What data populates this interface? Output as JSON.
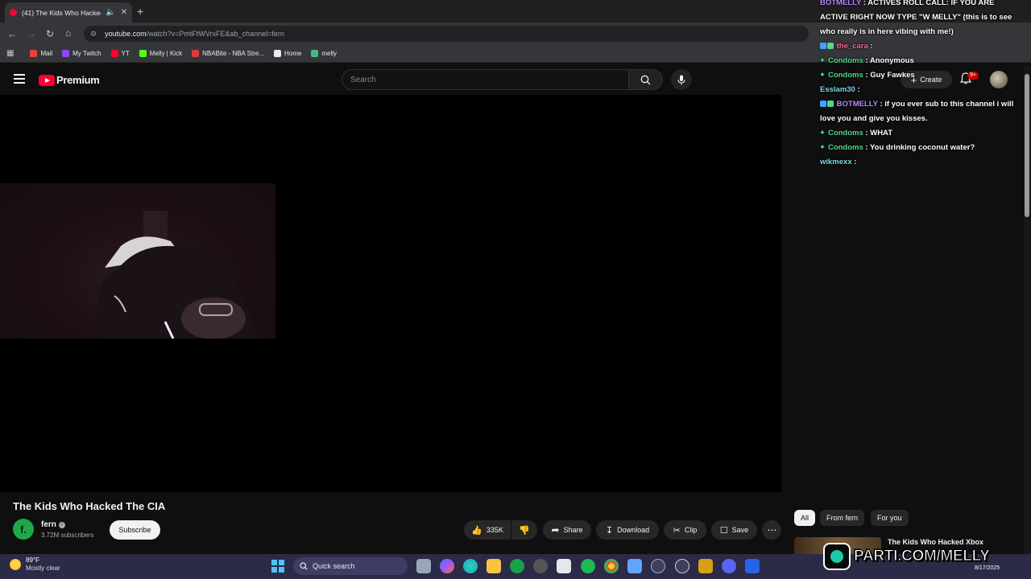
{
  "browser": {
    "tab_title": "(41) The Kids Who Hacked",
    "url_host": "youtube.com",
    "url_path": "/watch?v=PmtFtWVrxFE&ab_channel=fern",
    "bookmarks": [
      {
        "label": "Mail",
        "color": "#ea4335"
      },
      {
        "label": "My Twitch",
        "color": "#9146ff"
      },
      {
        "label": "YT",
        "color": "#ff0033"
      },
      {
        "label": "Melly | Kick",
        "color": "#53fc18"
      },
      {
        "label": "NBABite - NBA Stre...",
        "color": "#e03a3a"
      },
      {
        "label": "Home",
        "color": "#e8eaed"
      },
      {
        "label": "melly",
        "color": "#3fbf7f"
      }
    ]
  },
  "youtube": {
    "logo_text": "Premium",
    "search_placeholder": "Search",
    "create_label": "Create",
    "notif_count": "9+"
  },
  "chat": [
    {
      "prefix": "",
      "user": "BOTMELLY",
      "user_color": "#b389ff",
      "text": ": ACTIVES ROLL CALL: IF YOU ARE"
    },
    {
      "prefix": "",
      "user": "",
      "user_color": "#ffffff",
      "text": "ACTIVE RIGHT NOW TYPE \"W MELLY\" (this is to see"
    },
    {
      "prefix": "",
      "user": "",
      "user_color": "#ffffff",
      "text": "who really is in here vibing with me!)"
    },
    {
      "prefix": "badges",
      "user": "the_cara",
      "user_color": "#ff6b9a",
      "text": ":"
    },
    {
      "prefix": "sparkle",
      "user": "Condoms",
      "user_color": "#58d68d",
      "text": ": Anonymous"
    },
    {
      "prefix": "sparkle",
      "user": "Condoms",
      "user_color": "#58d68d",
      "text": ": Guy Fawkes"
    },
    {
      "prefix": "",
      "user": "Esslam30",
      "user_color": "#7fd6e6",
      "text": ":"
    },
    {
      "prefix": "badges",
      "user": "BOTMELLY",
      "user_color": "#b389ff",
      "text": ": if you ever sub to this channel i will"
    },
    {
      "prefix": "",
      "user": "",
      "user_color": "#ffffff",
      "text": "love you and give you kisses."
    },
    {
      "prefix": "sparkle",
      "user": "Condoms",
      "user_color": "#58d68d",
      "text": ": WHAT"
    },
    {
      "prefix": "sparkle",
      "user": "Condoms",
      "user_color": "#58d68d",
      "text": ": You drinking coconut water?"
    },
    {
      "prefix": "",
      "user": "wikmexx",
      "user_color": "#7fd6e6",
      "text": ":"
    }
  ],
  "video": {
    "title": "The Kids Who Hacked The CIA",
    "channel": "fern",
    "channel_initial": "f.",
    "subscribers": "3.72M subscribers",
    "subscribe_label": "Subscribe",
    "likes": "335K",
    "share_label": "Share",
    "download_label": "Download",
    "clip_label": "Clip",
    "save_label": "Save"
  },
  "sidebar": {
    "chips": [
      "All",
      "From fern",
      "For you"
    ],
    "rec_title": "The Kids Who Hacked Xbox"
  },
  "overlay": {
    "parti_text": "PARTI.COM/MELLY"
  },
  "taskbar": {
    "temp": "89°F",
    "weather": "Mostly clear",
    "search": "Quick search",
    "date": "8/17/2025"
  }
}
